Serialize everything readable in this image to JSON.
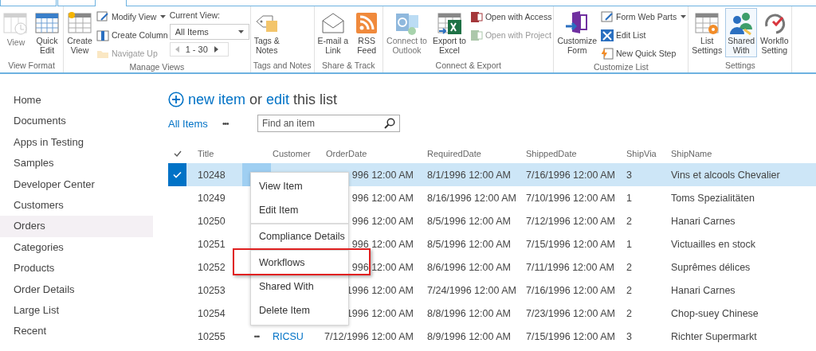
{
  "ribbon": {
    "groups": [
      {
        "label": "View Format",
        "items": [
          {
            "kind": "large",
            "label": [
              "View"
            ],
            "disabled": true
          },
          {
            "kind": "large",
            "label": [
              "Quick",
              "Edit"
            ],
            "disabled": false
          }
        ]
      },
      {
        "label": "Manage Views",
        "items": [
          {
            "kind": "large",
            "label": [
              "Create",
              "View"
            ],
            "disabled": false
          },
          {
            "kind": "stack",
            "entries": [
              {
                "label": "Modify View",
                "caret": true,
                "disabled": false
              },
              {
                "label": "Create Column",
                "caret": false,
                "disabled": false
              },
              {
                "label": "Navigate Up",
                "caret": false,
                "disabled": true
              }
            ]
          },
          {
            "kind": "viewpicker",
            "caption": "Current View:",
            "value": "All Items",
            "range": "1 - 30"
          }
        ]
      },
      {
        "label": "Tags and Notes",
        "items": [
          {
            "kind": "large",
            "label": [
              "Tags &",
              "Notes"
            ],
            "disabled": false
          }
        ]
      },
      {
        "label": "Share & Track",
        "items": [
          {
            "kind": "large",
            "label": [
              "E-mail a",
              "Link"
            ],
            "disabled": false
          },
          {
            "kind": "large",
            "label": [
              "RSS",
              "Feed"
            ],
            "disabled": false
          }
        ]
      },
      {
        "label": "Connect & Export",
        "items": [
          {
            "kind": "large",
            "label": [
              "Connect to",
              "Outlook"
            ],
            "disabled": true
          },
          {
            "kind": "large",
            "label": [
              "Export to",
              "Excel"
            ],
            "disabled": false
          },
          {
            "kind": "stack",
            "entries": [
              {
                "label": "Open with Access",
                "caret": false,
                "disabled": false
              },
              {
                "label": "Open with Project",
                "caret": false,
                "disabled": true
              }
            ]
          }
        ]
      },
      {
        "label": "Customize List",
        "items": [
          {
            "kind": "large",
            "label": [
              "Customize",
              "Form"
            ],
            "disabled": false
          },
          {
            "kind": "stack",
            "entries": [
              {
                "label": "Form Web Parts",
                "caret": true,
                "disabled": false
              },
              {
                "label": "Edit List",
                "caret": false,
                "disabled": false
              },
              {
                "label": "New Quick Step",
                "caret": false,
                "disabled": false
              }
            ]
          }
        ]
      },
      {
        "label": "Settings",
        "items": [
          {
            "kind": "large",
            "label": [
              "List",
              "Settings"
            ],
            "disabled": false,
            "selected": false
          },
          {
            "kind": "large",
            "label": [
              "Shared",
              "With"
            ],
            "disabled": false,
            "selected": true
          },
          {
            "kind": "large",
            "label": [
              "Workflo",
              "Setting"
            ],
            "disabled": false,
            "selected": false
          }
        ]
      }
    ]
  },
  "sidebar": {
    "items": [
      {
        "label": "Home",
        "selected": false
      },
      {
        "label": "Documents",
        "selected": false
      },
      {
        "label": "Apps in Testing",
        "selected": false
      },
      {
        "label": "Samples",
        "selected": false
      },
      {
        "label": "Developer Center",
        "selected": false
      },
      {
        "label": "Customers",
        "selected": false
      },
      {
        "label": "Orders",
        "selected": true
      },
      {
        "label": "Categories",
        "selected": false
      },
      {
        "label": "Products",
        "selected": false
      },
      {
        "label": "Order Details",
        "selected": false
      },
      {
        "label": "Large List",
        "selected": false
      },
      {
        "label": "Recent",
        "selected": false
      }
    ]
  },
  "header": {
    "new_item": "new item",
    "joiner": "or",
    "edit": "edit",
    "rest": "this list"
  },
  "toolbar": {
    "view": "All Items",
    "more": "•••",
    "search": {
      "placeholder": "Find an item"
    }
  },
  "table": {
    "columns": [
      "Title",
      "Customer",
      "OrderDate",
      "RequiredDate",
      "ShippedDate",
      "ShipVia",
      "ShipName"
    ],
    "rows": [
      {
        "selected": true,
        "menu_open": true,
        "cells": [
          "10248",
          "",
          "996 12:00 AM",
          "8/1/1996 12:00 AM",
          "7/16/1996 12:00 AM",
          "3",
          "Vins et alcools Chevalier"
        ]
      },
      {
        "selected": false,
        "menu_open": false,
        "cells": [
          "10249",
          "",
          "996 12:00 AM",
          "8/16/1996 12:00 AM",
          "7/10/1996 12:00 AM",
          "1",
          "Toms Spezialitäten"
        ]
      },
      {
        "selected": false,
        "menu_open": false,
        "cells": [
          "10250",
          "",
          "996 12:00 AM",
          "8/5/1996 12:00 AM",
          "7/12/1996 12:00 AM",
          "2",
          "Hanari Carnes"
        ]
      },
      {
        "selected": false,
        "menu_open": false,
        "cells": [
          "10251",
          "",
          "996 12:00 AM",
          "8/5/1996 12:00 AM",
          "7/15/1996 12:00 AM",
          "1",
          "Victuailles en stock"
        ]
      },
      {
        "selected": false,
        "menu_open": false,
        "cells": [
          "10252",
          "",
          "996 12:00 AM",
          "8/6/1996 12:00 AM",
          "7/11/1996 12:00 AM",
          "2",
          "Suprêmes délices"
        ]
      },
      {
        "selected": false,
        "menu_open": false,
        "cells": [
          "10253",
          "",
          "1996 12:00 AM",
          "7/24/1996 12:00 AM",
          "7/16/1996 12:00 AM",
          "2",
          "Hanari Carnes"
        ]
      },
      {
        "selected": false,
        "menu_open": false,
        "cells": [
          "10254",
          "",
          "1996 12:00 AM",
          "8/8/1996 12:00 AM",
          "7/23/1996 12:00 AM",
          "2",
          "Chop-suey Chinese"
        ]
      },
      {
        "selected": false,
        "menu_open": false,
        "ellipsis": "•••",
        "cells": [
          "10255",
          "RICSU",
          "7/12/1996 12:00 AM",
          "8/9/1996 12:00 AM",
          "7/15/1996 12:00 AM",
          "3",
          "Richter Supermarkt"
        ]
      }
    ]
  },
  "context_menu": {
    "items": [
      {
        "label": "View Item",
        "divider_before": false,
        "highlighted": false
      },
      {
        "label": "Edit Item",
        "divider_before": false,
        "highlighted": false
      },
      {
        "label": "Compliance Details",
        "divider_before": true,
        "highlighted": false
      },
      {
        "label": "Workflows",
        "divider_before": true,
        "highlighted": true
      },
      {
        "label": "Shared With",
        "divider_before": false,
        "highlighted": false
      },
      {
        "label": "Delete Item",
        "divider_before": false,
        "highlighted": false
      }
    ]
  }
}
